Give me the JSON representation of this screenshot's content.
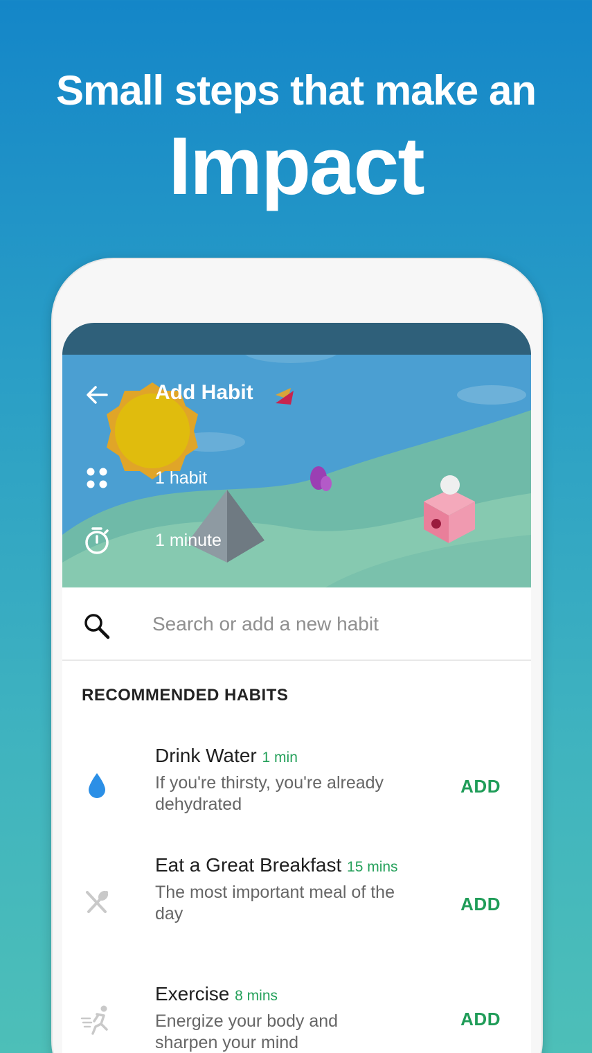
{
  "headline": {
    "line1": "Small steps that make an",
    "line2": "Impact"
  },
  "header": {
    "title": "Add Habit",
    "back_icon": "arrow-left-icon",
    "habit_count": "1 habit",
    "duration": "1 minute"
  },
  "search": {
    "placeholder": "Search or add a new habit",
    "value": ""
  },
  "recommended": {
    "title": "RECOMMENDED HABITS",
    "add_label": "ADD",
    "items": [
      {
        "name": "Drink Water",
        "duration": "1 min",
        "description": "If you're thirsty, you're already dehydrated",
        "icon": "water-drop-icon"
      },
      {
        "name": "Eat a Great Breakfast",
        "duration": "15 mins",
        "description": "The most important meal of the day",
        "icon": "utensils-icon"
      },
      {
        "name": "Exercise",
        "duration": "8 mins",
        "description": "Energize your body and sharpen your mind",
        "icon": "running-icon"
      }
    ]
  },
  "colors": {
    "accent_green": "#1f9c58",
    "water_blue": "#2b8fe6",
    "hero_sky": "#4b9fd2",
    "status_bar": "#2f607a"
  }
}
